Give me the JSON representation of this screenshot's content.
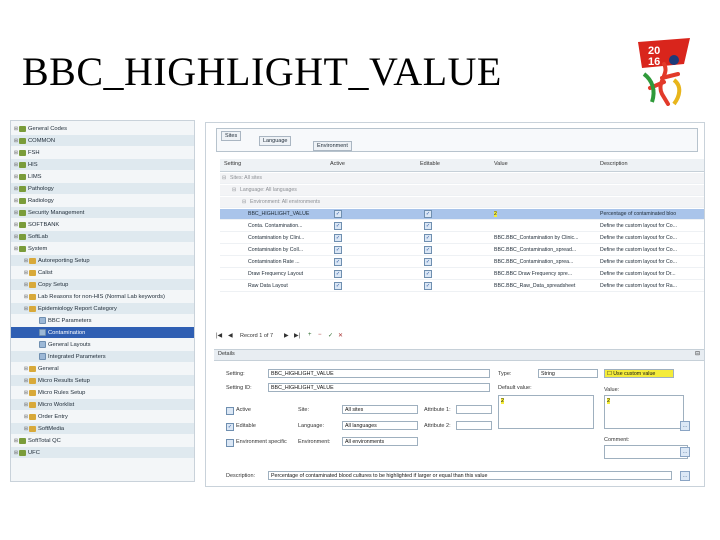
{
  "slide": {
    "title": "BBC_HIGHLIGHT_VALUE"
  },
  "logo": {
    "year_top": "20",
    "year_bottom": "16"
  },
  "tree": {
    "items": [
      {
        "label": "General Codes",
        "level": 0
      },
      {
        "label": "COMMON",
        "level": 0
      },
      {
        "label": "FSH",
        "level": 0
      },
      {
        "label": "HIS",
        "level": 0
      },
      {
        "label": "LIMS",
        "level": 0
      },
      {
        "label": "Pathology",
        "level": 0
      },
      {
        "label": "Radiology",
        "level": 0
      },
      {
        "label": "Security Management",
        "level": 0
      },
      {
        "label": "SOFTBANK",
        "level": 0
      },
      {
        "label": "SoftLab",
        "level": 0
      },
      {
        "label": "System",
        "level": 0
      },
      {
        "label": "Autoreporting Setup",
        "level": 1
      },
      {
        "label": "Calist",
        "level": 1
      },
      {
        "label": "Copy Setup",
        "level": 1
      },
      {
        "label": "Lab Reasons for non-HIS (Normal Lab keywords)",
        "level": 1
      },
      {
        "label": "Epidemiology Report Category",
        "level": 1
      },
      {
        "label": "BBC Parameters",
        "level": 2
      },
      {
        "label": "Contamination",
        "level": 2
      },
      {
        "label": "General Layouts",
        "level": 2
      },
      {
        "label": "Integrated Parameters",
        "level": 2
      },
      {
        "label": "General",
        "level": 1
      },
      {
        "label": "Micro Results Setup",
        "level": 1
      },
      {
        "label": "Micro Rules Setup",
        "level": 1
      },
      {
        "label": "Micro Worklist",
        "level": 1
      },
      {
        "label": "Order Entry",
        "level": 1
      },
      {
        "label": "SoftMedia",
        "level": 1
      },
      {
        "label": "SoftTotal QC",
        "level": 0
      },
      {
        "label": "UFC",
        "level": 0
      }
    ]
  },
  "filter": {
    "sites": "Sites",
    "language": "Language",
    "environment": "Environment"
  },
  "grid": {
    "headers": [
      "Setting",
      "Active",
      "Editable",
      "Value",
      "Description"
    ],
    "group_sites": "Sites: All sites",
    "group_language": "Language: All languages",
    "group_env": "Environment: All environments",
    "rows": [
      {
        "setting": "BBC_HIGHLIGHT_VALUE",
        "value": "2",
        "desc": "Percentage of contaminated bloo"
      },
      {
        "setting": "Conta. Contamination...",
        "value": "",
        "desc": "Define the custom layout for Co..."
      },
      {
        "setting": "Contamination by Clini...",
        "value": "BBC.BBC_Contamination by Clinic...",
        "desc": "Define the custom layout for Co..."
      },
      {
        "setting": "Contamination by Coll...",
        "value": "BBC.BBC_Contamination_spread...",
        "desc": "Define the custom layout for Co..."
      },
      {
        "setting": "Contamination Rate ...",
        "value": "BBC.BBC_Contamination_sprea...",
        "desc": "Define the custom layout for Co..."
      },
      {
        "setting": "Draw Frequency Layout",
        "value": "BBC.BBC Draw Frequency spre...",
        "desc": "Define the custom layout for Dr..."
      },
      {
        "setting": "Raw Data Layout",
        "value": "BBC.BBC_Raw_Data_spreadsheet",
        "desc": "Define the custom layout for Ra..."
      }
    ]
  },
  "pager": {
    "text": "Record 1 of 7"
  },
  "details": {
    "header": "Details",
    "setting_label": "Setting:",
    "setting_value": "BBC_HIGHLIGHT_VALUE",
    "setting_id_label": "Setting ID:",
    "setting_id_value": "BBC_HIGHLIGHT_VALUE",
    "active_label": "Active",
    "editable_label": "Editable",
    "env_specific_label": "Environment specific",
    "site_label": "Site:",
    "site_value": "All sites",
    "language_label": "Language:",
    "language_value": "All languages",
    "environment_label": "Environment:",
    "environment_value": "All environments",
    "attr1_label": "Attribute 1:",
    "attr2_label": "Attribute 2:",
    "type_label": "Type:",
    "type_value": "String",
    "custom_value": "Use custom value",
    "default_label": "Default value:",
    "default_value": "2",
    "value_label": "Value:",
    "value_value": "2",
    "comment_label": "Comment:",
    "description_label": "Description:",
    "description_value": "Percentage of contaminated blood cultures to be highlighted if larger or equal than this value"
  }
}
